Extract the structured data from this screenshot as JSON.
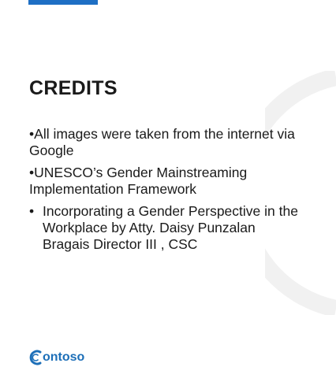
{
  "slide": {
    "title": "CREDITS",
    "credits": [
      {
        "bullet": "•",
        "text": "All images were taken from the internet via Google"
      },
      {
        "bullet": "•",
        "text": "UNESCO’s Gender Mainstreaming Implementation Framework"
      },
      {
        "bullet": "•",
        "text": "Incorporating a Gender Perspective in the Workplace by Atty. Daisy Punzalan Bragais Director III , CSC"
      }
    ]
  },
  "logo": {
    "text": "ontoso",
    "icon": "contoso-c-logo-icon"
  },
  "colors": {
    "accent": "#1e6fc4",
    "logo": "#1d6fb8",
    "arc": "#f1f1f1",
    "text": "#1a1a1a"
  }
}
